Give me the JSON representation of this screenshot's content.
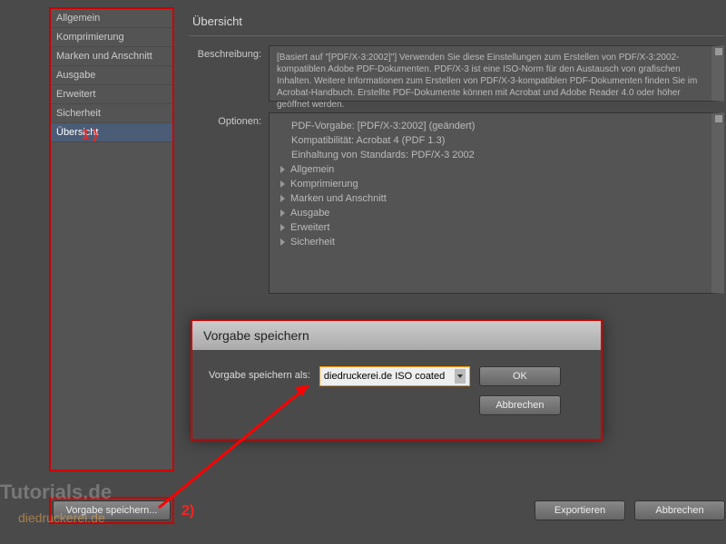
{
  "sidebar": {
    "items": [
      {
        "label": "Allgemein"
      },
      {
        "label": "Komprimierung"
      },
      {
        "label": "Marken und Anschnitt"
      },
      {
        "label": "Ausgabe"
      },
      {
        "label": "Erweitert"
      },
      {
        "label": "Sicherheit"
      },
      {
        "label": "Übersicht"
      }
    ],
    "selected_index": 6
  },
  "page": {
    "title": "Übersicht",
    "description_label": "Beschreibung:",
    "description_text": "[Basiert auf \"[PDF/X-3:2002]\"] Verwenden Sie diese Einstellungen zum Erstellen von PDF/X-3:2002-kompatiblen Adobe PDF-Dokumenten. PDF/X-3 ist eine ISO-Norm für den Austausch von grafischen Inhalten. Weitere Informationen zum Erstellen von PDF/X-3-kompatiblen PDF-Dokumenten finden Sie im Acrobat-Handbuch. Erstellte PDF-Dokumente können mit Acrobat und Adobe Reader 4.0 oder höher geöffnet werden.",
    "options_label": "Optionen:",
    "options": {
      "info": [
        "PDF-Vorgabe: [PDF/X-3:2002] (geändert)",
        "Kompatibilität: Acrobat 4 (PDF 1.3)",
        "Einhaltung von Standards: PDF/X-3 2002"
      ],
      "tree": [
        "Allgemein",
        "Komprimierung",
        "Marken und Anschnitt",
        "Ausgabe",
        "Erweitert",
        "Sicherheit"
      ]
    }
  },
  "save_dialog": {
    "title": "Vorgabe speichern",
    "label": "Vorgabe speichern als:",
    "value": "diedruckerei.de ISO coated",
    "ok": "OK",
    "cancel": "Abbrechen"
  },
  "bottom": {
    "save_preset": "Vorgabe speichern...",
    "export": "Exportieren",
    "cancel": "Abbrechen"
  },
  "annotations": {
    "one": "1 )",
    "two": "2)"
  },
  "watermark": {
    "a": "Tutorials.de",
    "b": "diedruckerei.de"
  }
}
